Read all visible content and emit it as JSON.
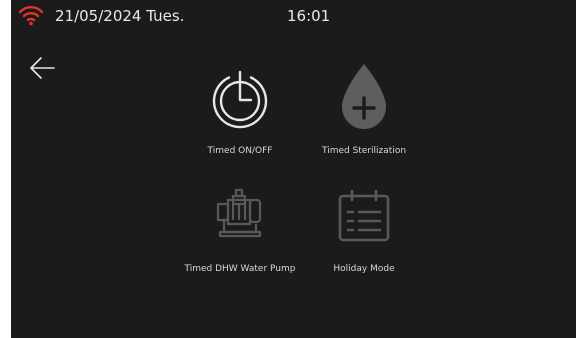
{
  "status_bar": {
    "wifi_icon": "wifi-icon",
    "date": "21/05/2024 Tues.",
    "time": "16:01"
  },
  "colors": {
    "background": "#1b1b1b",
    "wifi_accent": "#e0342d",
    "icon_light": "#e0e0e0",
    "icon_dim": "#5a5a5a",
    "text": "#d8d8d8"
  },
  "nav": {
    "back_icon": "arrow-left-icon"
  },
  "menu": {
    "items": [
      {
        "label": "Timed ON/OFF",
        "icon": "clock-power-icon",
        "enabled": true
      },
      {
        "label": "Timed Sterilization",
        "icon": "droplet-plus-icon",
        "enabled": true
      },
      {
        "label": "Timed DHW Water Pump",
        "icon": "water-pump-icon",
        "enabled": false
      },
      {
        "label": "Holiday Mode",
        "icon": "calendar-list-icon",
        "enabled": false
      }
    ]
  }
}
